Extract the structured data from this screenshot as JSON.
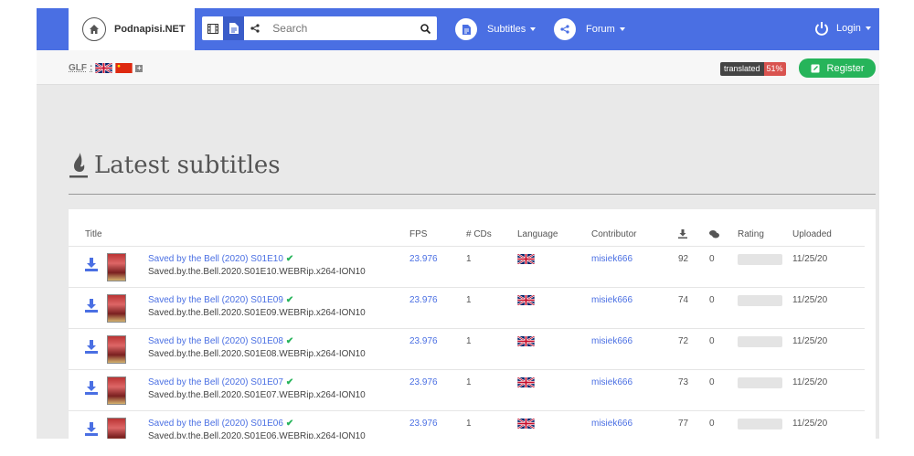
{
  "brand": {
    "name": "Podnapisi.NET"
  },
  "search": {
    "placeholder": "Search"
  },
  "nav": {
    "subtitles": "Subtitles",
    "forum": "Forum",
    "login": "Login"
  },
  "subbar": {
    "glf_label": "GLF",
    "glf_sep": ":",
    "translated_label": "translated",
    "translated_value": "51%",
    "register": "Register"
  },
  "page_title": "Latest subtitles",
  "table": {
    "headers": {
      "title": "Title",
      "fps": "FPS",
      "cds": "# CDs",
      "language": "Language",
      "contributor": "Contributor",
      "uploaded": "Uploaded"
    },
    "rows": [
      {
        "title": "Saved by the Bell (2020) S01E10",
        "release": "Saved.by.the.Bell.2020.S01E10.WEBRip.x264-ION10",
        "fps": "23.976",
        "cds": "1",
        "contributor": "misiek666",
        "downloads": "92",
        "comments": "0",
        "uploaded": "11/25/20"
      },
      {
        "title": "Saved by the Bell (2020) S01E09",
        "release": "Saved.by.the.Bell.2020.S01E09.WEBRip.x264-ION10",
        "fps": "23.976",
        "cds": "1",
        "contributor": "misiek666",
        "downloads": "74",
        "comments": "0",
        "uploaded": "11/25/20"
      },
      {
        "title": "Saved by the Bell (2020) S01E08",
        "release": "Saved.by.the.Bell.2020.S01E08.WEBRip.x264-ION10",
        "fps": "23.976",
        "cds": "1",
        "contributor": "misiek666",
        "downloads": "72",
        "comments": "0",
        "uploaded": "11/25/20"
      },
      {
        "title": "Saved by the Bell (2020) S01E07",
        "release": "Saved.by.the.Bell.2020.S01E07.WEBRip.x264-ION10",
        "fps": "23.976",
        "cds": "1",
        "contributor": "misiek666",
        "downloads": "73",
        "comments": "0",
        "uploaded": "11/25/20"
      },
      {
        "title": "Saved by the Bell (2020) S01E06",
        "release": "Saved.by.the.Bell.2020.S01E06.WEBRip.x264-ION10",
        "fps": "23.976",
        "cds": "1",
        "contributor": "misiek666",
        "downloads": "77",
        "comments": "0",
        "uploaded": "11/25/20"
      }
    ]
  },
  "colors": {
    "primary": "#4a6fe3",
    "success": "#26b45a",
    "danger": "#d9534f"
  },
  "icons": [
    "home-icon",
    "film-icon",
    "document-icon",
    "share-icon",
    "search-icon",
    "power-icon",
    "edit-icon",
    "flame-icon",
    "download-icon",
    "comment-icon",
    "check-icon",
    "uk-flag-icon",
    "china-flag-icon"
  ]
}
